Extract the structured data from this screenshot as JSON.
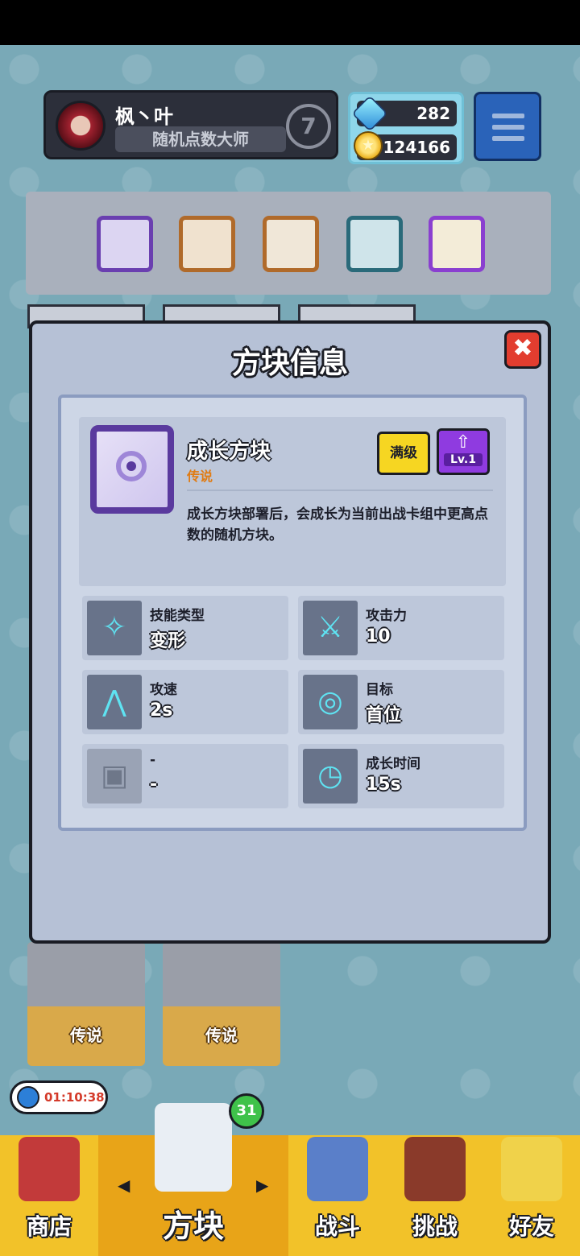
{
  "player": {
    "name": "枫丶叶",
    "title": "随机点数大师",
    "rank": "7"
  },
  "currency": {
    "gems": "282",
    "coins": "124166"
  },
  "dialog": {
    "title": "方块信息",
    "close_label": "✖",
    "dice_name": "成长方块",
    "rarity": "传说",
    "max_label": "满级",
    "level_label": "Lv.1",
    "description": "成长方块部署后，会成长为当前出战卡组中更高点数的随机方块。",
    "stats": [
      {
        "label": "技能类型",
        "value": "变形",
        "icon": "transform-icon"
      },
      {
        "label": "攻击力",
        "value": "10",
        "icon": "crossed-swords-icon"
      },
      {
        "label": "攻速",
        "value": "2s",
        "icon": "speed-icon"
      },
      {
        "label": "目标",
        "value": "首位",
        "icon": "target-icon"
      },
      {
        "label": "-",
        "value": "-",
        "icon": "empty-icon"
      },
      {
        "label": "成长时间",
        "value": "15s",
        "icon": "growth-timer-icon"
      }
    ]
  },
  "background_cards": [
    {
      "label": "传说"
    },
    {
      "label": "传说"
    }
  ],
  "timer": "01:10:38",
  "nav": {
    "badge": "31",
    "items": [
      {
        "label": "商店"
      },
      {
        "label": "方块"
      },
      {
        "label": "战斗"
      },
      {
        "label": "挑战"
      },
      {
        "label": "好友"
      }
    ]
  },
  "colors": {
    "accent_yellow": "#f2c229",
    "dialog_bg": "#b6c1d6",
    "close_red": "#e23d2f",
    "legend_orange": "#e07b12",
    "level_purple": "#8f3be0"
  }
}
